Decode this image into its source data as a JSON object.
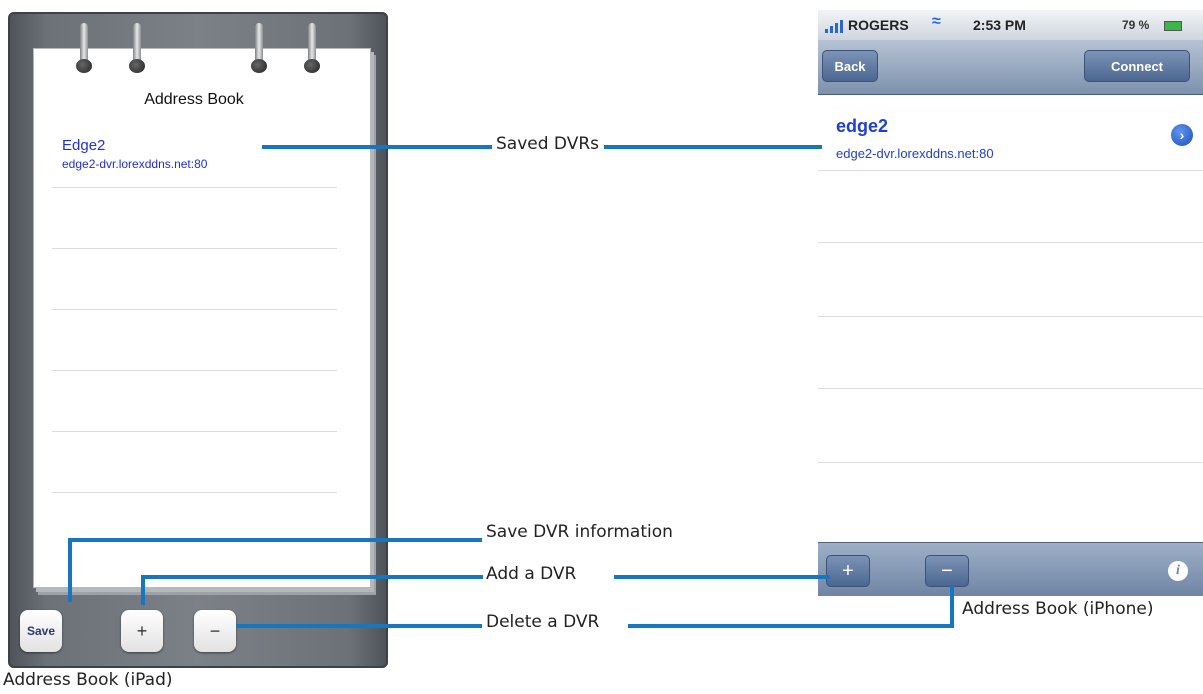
{
  "ipad": {
    "title": "Address Book",
    "entry": {
      "name": "Edge2",
      "host": "edge2-dvr.lorexddns.net:80"
    },
    "buttons": {
      "save": "Save",
      "add": "+",
      "remove": "−"
    },
    "caption": "Address Book (iPad)"
  },
  "iphone": {
    "status": {
      "carrier": "ROGERS",
      "time": "2:53 PM",
      "battery": "79 %"
    },
    "nav": {
      "back": "Back",
      "connect": "Connect"
    },
    "entry": {
      "name": "edge2",
      "host": "edge2-dvr.lorexddns.net:80"
    },
    "toolbar": {
      "add": "+",
      "remove": "−"
    },
    "caption": "Address Book (iPhone)"
  },
  "callouts": {
    "saved": "Saved DVRs",
    "save_info": "Save DVR information",
    "add": "Add a DVR",
    "delete": "Delete a DVR"
  },
  "colors": {
    "callout_line": "#1677c0",
    "link_blue": "#1d3fd4"
  }
}
